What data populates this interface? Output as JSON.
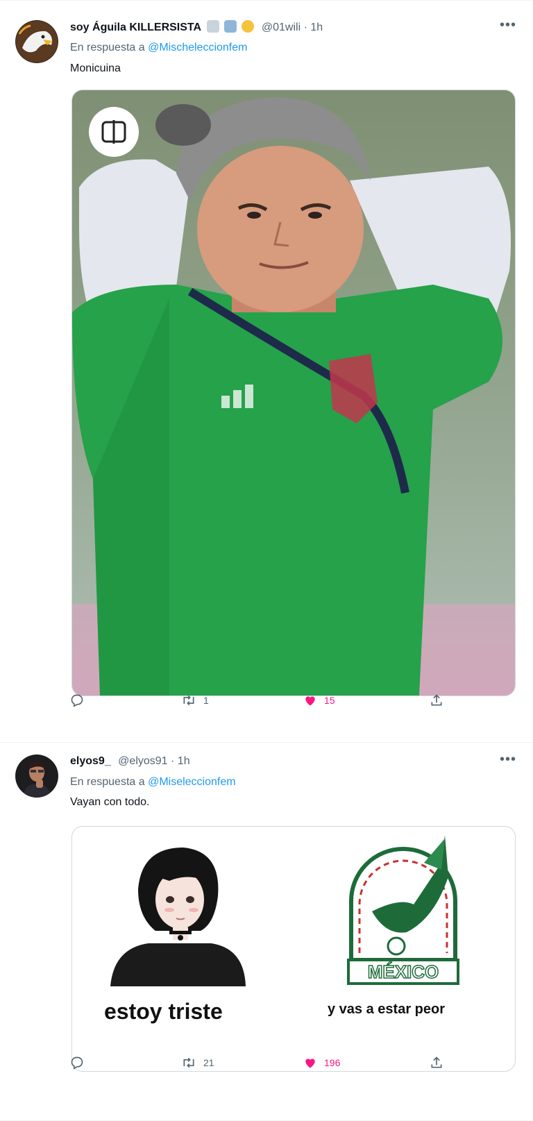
{
  "tweets": [
    {
      "name": "soy Águila KILLERSISTA",
      "handle": "@01wili",
      "time": "1h",
      "reply_prefix": "En respuesta a",
      "reply_to": "@Mischeleccionfem",
      "text": "Monicuina",
      "media_icon": "alt-layout-icon",
      "stats": {
        "replies": "",
        "retweets": "1",
        "likes": "15"
      }
    },
    {
      "name": "elyos9_",
      "handle": "@elyos91",
      "time": "1h",
      "reply_prefix": "En respuesta a",
      "reply_to": "@Miseleccionfem",
      "text": "Vayan con todo.",
      "meme_left": "estoy triste",
      "meme_right": "y vas a estar peor",
      "meme_logo_text": "MÉXICO",
      "stats": {
        "replies": "",
        "retweets": "21",
        "likes": "196"
      }
    }
  ],
  "colors": {
    "like": "#f91880",
    "mention": "#1d9bf0",
    "muted": "#536471",
    "jersey": "#1f9d45"
  }
}
